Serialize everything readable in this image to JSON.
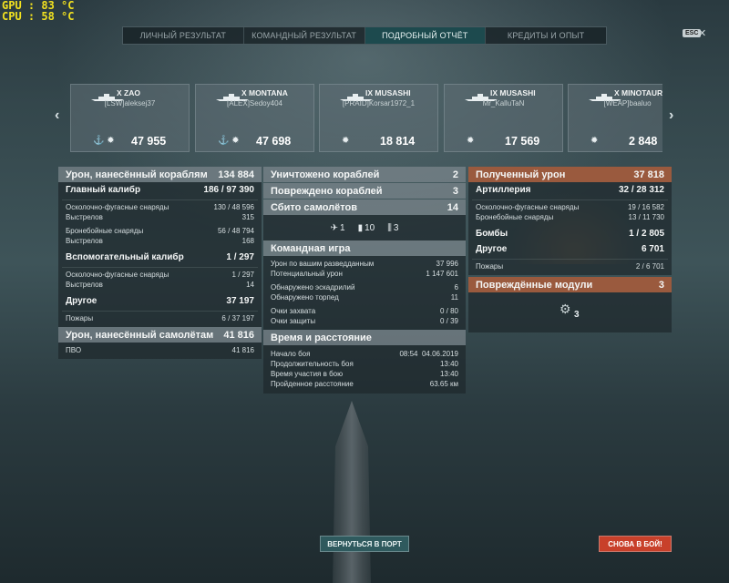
{
  "hud": {
    "gpu": "GPU : 83 °C",
    "cpu": "CPU : 58 °C"
  },
  "tabs": [
    {
      "label": "ЛИЧНЫЙ РЕЗУЛЬТАТ",
      "active": false
    },
    {
      "label": "КОМАНДНЫЙ РЕЗУЛЬТАТ",
      "active": false
    },
    {
      "label": "ПОДРОБНЫЙ ОТЧЁТ",
      "active": true
    },
    {
      "label": "КРЕДИТЫ И ОПЫТ",
      "active": false
    }
  ],
  "esc_label": "ESC",
  "cards": [
    {
      "name": "X ZAO",
      "player": "[LSW]aleksej37",
      "score": "47 955"
    },
    {
      "name": "X MONTANA",
      "player": "[ALEX]Sedoy404",
      "score": "47 698"
    },
    {
      "name": "IX MUSASHI",
      "player": "[PRAID]Korsar1972_1",
      "score": "18 814"
    },
    {
      "name": "IX MUSASHI",
      "player": "Mr_KalluTaN",
      "score": "17 569"
    },
    {
      "name": "X MINOTAUR",
      "player": "[WEAP]baaluo",
      "score": "2 848"
    }
  ],
  "left": {
    "damage_header": {
      "label": "Урон, нанесённый кораблям",
      "value": "134 884"
    },
    "main_battery": {
      "label": "Главный калибр",
      "value": "186 / 97 390"
    },
    "he": {
      "label": "Осколочно-фугасные снаряды",
      "value": "130 / 48 596"
    },
    "he_shots": {
      "label": "Выстрелов",
      "value": "315"
    },
    "ap": {
      "label": "Бронебойные снаряды",
      "value": "56 / 48 794"
    },
    "ap_shots": {
      "label": "Выстрелов",
      "value": "168"
    },
    "secondary": {
      "label": "Вспомогательный калибр",
      "value": "1 / 297"
    },
    "sec_he": {
      "label": "Осколочно-фугасные снаряды",
      "value": "1 / 297"
    },
    "sec_shots": {
      "label": "Выстрелов",
      "value": "14"
    },
    "other": {
      "label": "Другое",
      "value": "37 197"
    },
    "fires": {
      "label": "Пожары",
      "value": "6 / 37 197"
    },
    "air_damage": {
      "label": "Урон, нанесённый самолётам",
      "value": "41 816"
    },
    "aa": {
      "label": "ПВО",
      "value": "41 816"
    }
  },
  "mid": {
    "destroyed": {
      "label": "Уничтожено кораблей",
      "value": "2"
    },
    "damaged": {
      "label": "Повреждено кораблей",
      "value": "3"
    },
    "planes": {
      "label": "Сбито самолётов",
      "value": "14"
    },
    "plane_counts": [
      "1",
      "10",
      "3"
    ],
    "team_title": "Командная игра",
    "spotting": {
      "label": "Урон по вашим разведданным",
      "value": "37 996"
    },
    "potential": {
      "label": "Потенциальный урон",
      "value": "1 147 601"
    },
    "squadrons": {
      "label": "Обнаружено эскадрилий",
      "value": "6"
    },
    "torpedoes": {
      "label": "Обнаружено торпед",
      "value": "11"
    },
    "capture": {
      "label": "Очки захвата",
      "value": "0 / 80"
    },
    "defense": {
      "label": "Очки защиты",
      "value": "0 / 39"
    },
    "time_title": "Время и расстояние",
    "start": {
      "label": "Начало боя",
      "value": "08:54  04.06.2019"
    },
    "duration": {
      "label": "Продолжительность боя",
      "value": "13:40"
    },
    "participation": {
      "label": "Время участия в бою",
      "value": "13:40"
    },
    "distance": {
      "label": "Пройденное расстояние",
      "value": "63.65 км"
    }
  },
  "right": {
    "received": {
      "label": "Полученный урон",
      "value": "37 818"
    },
    "artillery": {
      "label": "Артиллерия",
      "value": "32 / 28 312"
    },
    "r_he": {
      "label": "Осколочно-фугасные снаряды",
      "value": "19 / 16 582"
    },
    "r_ap": {
      "label": "Бронебойные снаряды",
      "value": "13 / 11 730"
    },
    "bombs": {
      "label": "Бомбы",
      "value": "1 / 2 805"
    },
    "r_other": {
      "label": "Другое",
      "value": "6 701"
    },
    "r_fires": {
      "label": "Пожары",
      "value": "2 / 6 701"
    },
    "modules": {
      "label": "Повреждённые модули",
      "value": "3"
    },
    "module_count": "3"
  },
  "buttons": {
    "port": "ВЕРНУТЬСЯ В ПОРТ",
    "battle": "СНОВА В БОЙ!"
  },
  "colors": {
    "orange_header": "#9a5a3e",
    "active_tab": "#1d4a4e",
    "battle_button": "#c8402a"
  }
}
